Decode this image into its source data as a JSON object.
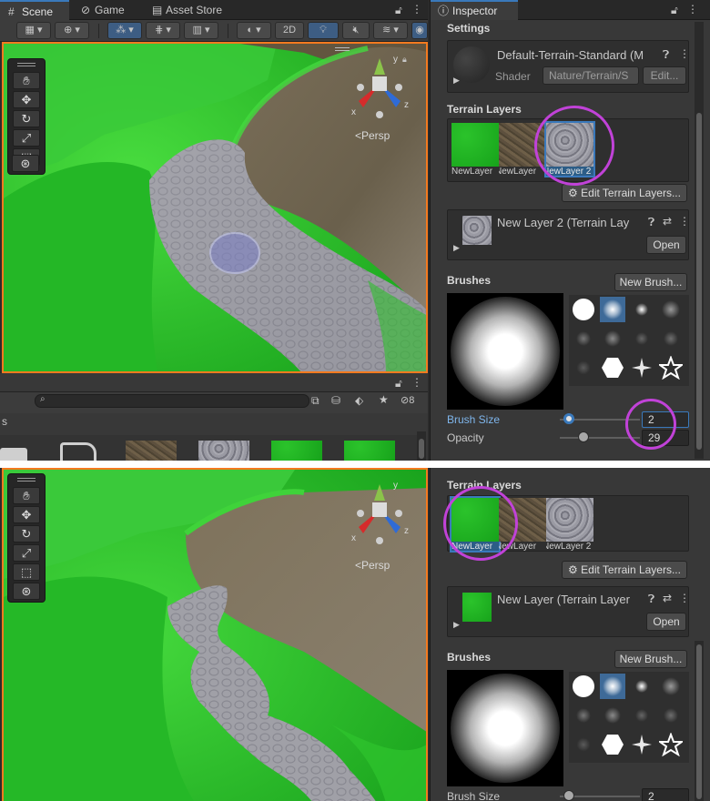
{
  "panel_a": {
    "tabs": [
      {
        "label": "Scene",
        "icon": "hash-icon"
      },
      {
        "label": "Game",
        "icon": "gamepad-icon"
      },
      {
        "label": "Asset Store",
        "icon": "store-icon"
      }
    ],
    "toolbar": {
      "btn_2d": "2D"
    },
    "viewport": {
      "persp_label": "<Persp",
      "axis_x": "x",
      "axis_y": "y",
      "axis_z": "z"
    },
    "inspector": {
      "tab_label": "Inspector",
      "settings_header": "Settings",
      "material_name": "Default-Terrain-Standard (M",
      "shader_label": "Shader",
      "shader_value": "Nature/Terrain/S",
      "edit_button": "Edit...",
      "terrain_layers_header": "Terrain Layers",
      "layers": [
        "NewLayer",
        "NewLayer",
        "NewLayer 2"
      ],
      "edit_terrain_layers": "Edit Terrain Layers...",
      "selected_layer_name": "New Layer 2 (Terrain Lay",
      "open_button": "Open",
      "brushes_header": "Brushes",
      "new_brush_button": "New Brush...",
      "brush_size_label": "Brush Size",
      "brush_size_value": "2",
      "opacity_label": "Opacity",
      "opacity_value": "29"
    },
    "project": {
      "filter_count": "8",
      "left_glyph": "s"
    }
  },
  "panel_b": {
    "viewport": {
      "persp_label": "<Persp",
      "axis_x": "x",
      "axis_y": "y",
      "axis_z": "z"
    },
    "inspector": {
      "terrain_layers_header": "Terrain Layers",
      "layers": [
        "NewLayer",
        "NewLayer",
        "NewLayer 2"
      ],
      "edit_terrain_layers": "Edit Terrain Layers...",
      "selected_layer_name": "New Layer (Terrain Layer",
      "open_button": "Open",
      "brushes_header": "Brushes",
      "new_brush_button": "New Brush...",
      "brush_size_label": "Brush Size",
      "brush_size_value": "2"
    }
  },
  "colors": {
    "accent": "#3a79bb",
    "highlight_circle": "#c142d8",
    "viewport_border": "#f47a1f",
    "grass": "#22b622"
  }
}
